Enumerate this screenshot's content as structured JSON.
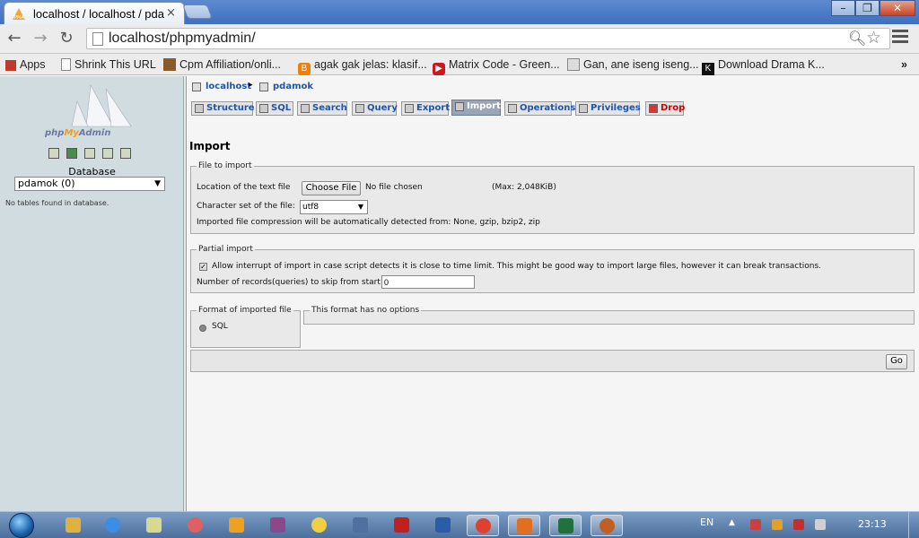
{
  "browser": {
    "tab_title": "localhost / localhost / pda",
    "tab_close": "×",
    "url": "localhost/phpmyadmin/",
    "window_buttons": {
      "minimize": "–",
      "restore": "❐",
      "close": "✕"
    }
  },
  "bookmarks": [
    {
      "label": "Apps",
      "icon": "apps-grid-icon",
      "color": "#c0392b"
    },
    {
      "label": "Shrink This URL",
      "icon": "page-icon",
      "color": "#ffffff"
    },
    {
      "label": "Cpm Affiliation/onli...",
      "icon": "chart-icon",
      "color": "#8a5a2b"
    },
    {
      "label": "agak gak jelas: klasif...",
      "icon": "blogger-icon",
      "color": "#f57d00"
    },
    {
      "label": "Matrix Code - Green...",
      "icon": "youtube-icon",
      "color": "#cc181e"
    },
    {
      "label": "Gan, ane iseng iseng...",
      "icon": "page-icon",
      "color": "#dddddd"
    },
    {
      "label": "Download Drama K...",
      "icon": "dk-icon",
      "color": "#111111"
    }
  ],
  "bookmarks_overflow": "»",
  "sidebar": {
    "logo_text": "phpMyAdmin",
    "database_label": "Database",
    "database_selected": "pdamok (0)",
    "no_tables": "No tables found in database."
  },
  "breadcrumb": {
    "server": "localhost",
    "database": "pdamok"
  },
  "tabs": [
    {
      "label": "Structure",
      "active": false
    },
    {
      "label": "SQL",
      "active": false
    },
    {
      "label": "Search",
      "active": false
    },
    {
      "label": "Query",
      "active": false
    },
    {
      "label": "Export",
      "active": false
    },
    {
      "label": "Import",
      "active": true
    },
    {
      "label": "Operations",
      "active": false
    },
    {
      "label": "Privileges",
      "active": false
    },
    {
      "label": "Drop",
      "active": false
    }
  ],
  "import": {
    "title": "Import",
    "file_to_import": {
      "legend": "File to import",
      "location_label": "Location of the text file",
      "choose_file_button": "Choose File",
      "no_file": "No file chosen",
      "max_size": "(Max: 2,048KiB)",
      "charset_label": "Character set of the file:",
      "charset_value": "utf8",
      "compression_note": "Imported file compression will be automatically detected from: None, gzip, bzip2, zip"
    },
    "partial_import": {
      "legend": "Partial import",
      "allow_interrupt_checked": true,
      "allow_interrupt_label": "Allow interrupt of import in case script detects it is close to time limit. This might be good way to import large files, however it can break transactions.",
      "skip_label": "Number of records(queries) to skip from start",
      "skip_value": "0"
    },
    "format": {
      "legend": "Format of imported file",
      "option": "SQL",
      "options_legend": "This format has no options"
    },
    "go_button": "Go"
  },
  "taskbar": {
    "language": "EN",
    "clock": "23:13",
    "items": [
      {
        "icon": "explorer-icon",
        "color": "#e0b040",
        "open": false
      },
      {
        "icon": "internet-explorer-icon",
        "color": "#3a8ee6",
        "open": false
      },
      {
        "icon": "notepad-icon",
        "color": "#d8d890",
        "open": false
      },
      {
        "icon": "paint-icon",
        "color": "#e06060",
        "open": false
      },
      {
        "icon": "media-player-icon",
        "color": "#f0a020",
        "open": false
      },
      {
        "icon": "winrar-icon",
        "color": "#8a4a8a",
        "open": false
      },
      {
        "icon": "skype-icon",
        "color": "#f0d040",
        "open": false
      },
      {
        "icon": "keyboard-icon",
        "color": "#5070a0",
        "open": false
      },
      {
        "icon": "filezilla-icon",
        "color": "#c02020",
        "open": false
      },
      {
        "icon": "word-icon",
        "color": "#2a5caa",
        "open": false
      },
      {
        "icon": "chrome-icon",
        "color": "#e04030",
        "open": true
      },
      {
        "icon": "xampp-icon",
        "color": "#e07020",
        "open": true
      },
      {
        "icon": "excel-icon",
        "color": "#207040",
        "open": true
      },
      {
        "icon": "media-center-icon",
        "color": "#c06020",
        "open": true
      }
    ]
  }
}
